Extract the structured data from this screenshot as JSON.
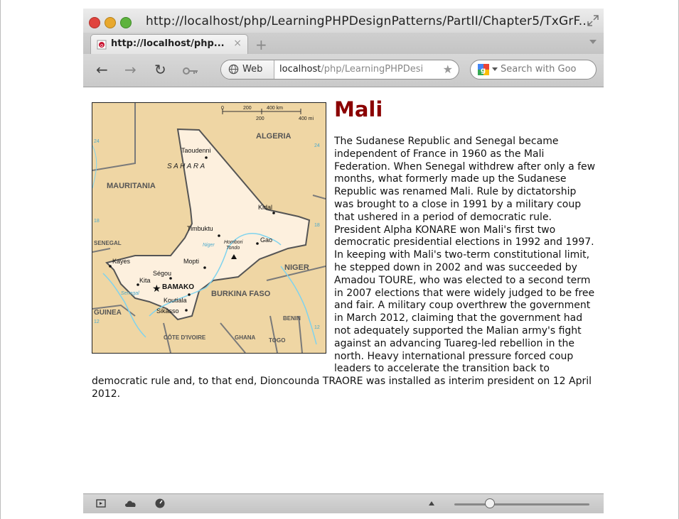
{
  "window": {
    "title": "http://localhost/php/LearningPHPDesignPatterns/PartII/Chapter5/TxGrF..."
  },
  "tab": {
    "label": "http://localhost/php...",
    "close": "×",
    "new_tab": "+"
  },
  "toolbar": {
    "identity_label": "Web",
    "url_host": "localhost",
    "url_path": "/php/LearningPHPDesi",
    "search_placeholder": "Search with Goo"
  },
  "page": {
    "heading": "Mali",
    "body": "The Sudanese Republic and Senegal became independent of France in 1960 as the Mali Federation. When Senegal withdrew after only a few months, what formerly made up the Sudanese Republic was renamed Mali. Rule by dictatorship was brought to a close in 1991 by a military coup that ushered in a period of democratic rule. President Alpha KONARE won Mali's first two democratic presidential elections in 1992 and 1997. In keeping with Mali's two-term constitutional limit, he stepped down in 2002 and was succeeded by Amadou TOURE, who was elected to a second term in 2007 elections that were widely judged to be free and fair. A military coup overthrew the government in March 2012, claiming that the government had not adequately supported the Malian army's fight against an advancing Tuareg-led rebellion in the north. Heavy international pressure forced coup leaders to accelerate the transition back to democratic rule and, to that end, Dioncounda TRAORE was installed as interim president on 12 April 2012."
  },
  "map": {
    "scale_0": "0",
    "scale_200": "200",
    "scale_400km": "400 km",
    "scale_200b": "200",
    "scale_400mi": "400 mi",
    "algeria": "ALGERIA",
    "taoudenni": "Taoudenni",
    "sahara": "S   A   H   A   R   A",
    "mauritania": "MAURITANIA",
    "kidal": "Kidal",
    "timbuktu": "Timbuktu",
    "niger_river": "Niger",
    "hombori": "Hombori",
    "tondo": "Tondo",
    "gao": "Gao",
    "senegal": "SENEGAL",
    "kayes": "Kayes",
    "mopti": "Mopti",
    "niger": "NIGER",
    "kita": "Kita",
    "segou": "Ségou",
    "bamako": "BAMAKO",
    "koutiala": "Koutiala",
    "burkina": "BURKINA FASO",
    "guinea": "GUINEA",
    "sikasso": "Sikasso",
    "benin": "BENIN",
    "cote": "CÔTE D'IVOIRE",
    "ghana": "GHANA",
    "togo": "TOGO",
    "senegal_river": "Senegal",
    "lat24": "24",
    "lat18": "18",
    "lat12": "12"
  },
  "colors": {
    "heading": "#8b0000",
    "map_land": "#efd6a4",
    "map_mali": "#fdf0de",
    "map_water": "#7fd3ee"
  }
}
